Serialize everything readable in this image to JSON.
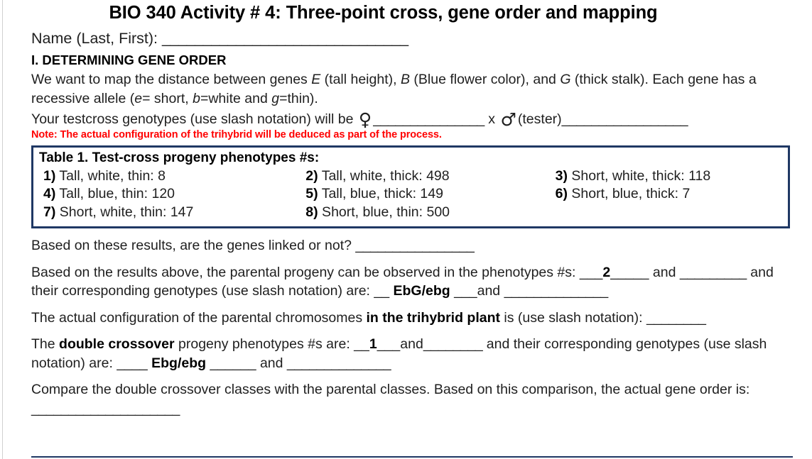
{
  "document": {
    "title": "BIO 340 Activity # 4: Three-point cross, gene order and mapping",
    "name_label": "Name (Last, First):",
    "name_blank": "______________________________",
    "section_heading": "I. DETERMINING GENE ORDER",
    "intro_paragraph": {
      "part1": "We want to map the distance between genes ",
      "gene_e": "E",
      "part2": " (tall height), ",
      "gene_b": "B",
      "part3": " (Blue flower color), and ",
      "gene_g": "G",
      "part4": " (thick stalk). Each gene has a recessive allele (",
      "allele_e": "e",
      "part5": "= short, ",
      "allele_b": "b",
      "part6": "=white and ",
      "allele_g": "g",
      "part7": "=thin)."
    },
    "testcross_line": {
      "text_before": "Your testcross genotypes (use slash notation) will be",
      "female_symbol": "♀",
      "blank_female": "_______________",
      "cross_x": "x",
      "male_symbol": "♂",
      "tester_label": "(tester)",
      "blank_male": "_________________"
    },
    "red_note": "Note: The actual configuration of the trihybrid will be deduced as part of the process."
  },
  "table1": {
    "caption": "Table 1. Test-cross progeny phenotypes #s:",
    "border_color": "#1f3864",
    "rows": [
      [
        {
          "num": "1)",
          "text": " Tall, white, thin: 8"
        },
        {
          "num": "2)",
          "text": " Tall, white, thick: 498"
        },
        {
          "num": "3)",
          "text": " Short, white, thick: 118"
        }
      ],
      [
        {
          "num": "4)",
          "text": " Tall, blue, thin: 120"
        },
        {
          "num": "5)",
          "text": " Tall, blue, thick: 149"
        },
        {
          "num": "6)",
          "text": " Short, blue, thick: 7"
        }
      ],
      [
        {
          "num": "7)",
          "text": " Short, white, thin: 147"
        },
        {
          "num": "8)",
          "text": " Short, blue, thin: 500"
        },
        {
          "num": "",
          "text": ""
        }
      ]
    ]
  },
  "questions": {
    "q_linked": {
      "text": "Based on these results, are the genes linked or not? ",
      "blank": "________________"
    },
    "q_parental": {
      "text1": "Based on the results above, the parental progeny can be observed in the phenotypes #s: ___",
      "answer1": "2",
      "text2": "_____ and ",
      "blank1": "_________",
      "text3": " and their corresponding genotypes (use slash notation) are:  __ ",
      "answer2": "EbG/ebg",
      "text4": " ___and ",
      "blank2": "______________"
    },
    "q_config": {
      "text1": "The actual configuration of the parental chromosomes ",
      "bold": "in the trihybrid plant",
      "text2": " is (use slash notation): ",
      "blank": "________"
    },
    "q_double": {
      "text1": "The ",
      "bold": "double crossover",
      "text2": " progeny phenotypes #s are: __",
      "answer1": "1",
      "text3": "___and",
      "blank1": "________",
      "text4": " and their corresponding genotypes (use slash notation) are: ____ ",
      "answer2": "Ebg/ebg",
      "text5": " ______ and ",
      "blank2": "______________"
    },
    "q_order": {
      "text": "Compare the double crossover classes with the parental classes. Based on this comparison, the actual gene order is: ",
      "blank": "____________________"
    }
  }
}
